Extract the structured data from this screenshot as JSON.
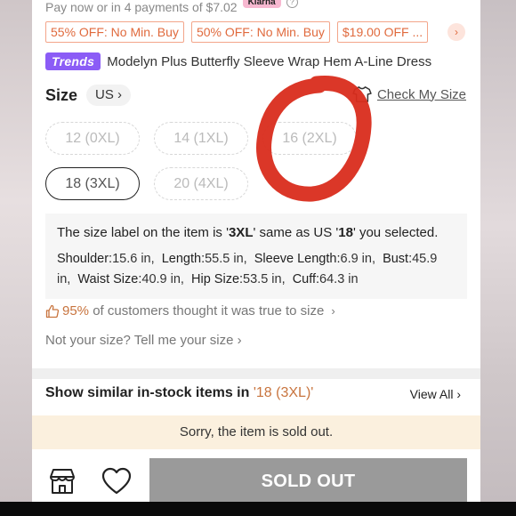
{
  "payment": {
    "text": "Pay now or in 4 payments of $7.02",
    "badge": "Klarna",
    "help": "?"
  },
  "coupons": [
    "55% OFF: No Min. Buy",
    "50% OFF: No Min. Buy",
    "$19.00 OFF ..."
  ],
  "coupons_more": "›",
  "product": {
    "badge": "Trends",
    "title": "Modelyn Plus Butterfly Sleeve Wrap Hem A-Line Dress"
  },
  "size_section": {
    "label": "Size",
    "region": "US ›",
    "check_my_size": "Check My Size"
  },
  "sizes": [
    {
      "label": "12 (0XL)",
      "selected": false
    },
    {
      "label": "14 (1XL)",
      "selected": false
    },
    {
      "label": "16 (2XL)",
      "selected": false
    },
    {
      "label": "18 (3XL)",
      "selected": true
    },
    {
      "label": "20 (4XL)",
      "selected": false
    }
  ],
  "size_info": {
    "pre": "The size label on the item is '",
    "item_label": "3XL",
    "mid": "' same as US '",
    "us_size": "18",
    "post": "' you selected.",
    "measurements": [
      {
        "k": "Shoulder:",
        "v": "15.6 in,"
      },
      {
        "k": "Length:",
        "v": "55.5 in,"
      },
      {
        "k": "Sleeve Length:",
        "v": "6.9 in,"
      },
      {
        "k": "Bust:",
        "v": "45.9 in,"
      },
      {
        "k": "Waist Size:",
        "v": "40.9 in,"
      },
      {
        "k": "Hip Size:",
        "v": "53.5 in,"
      },
      {
        "k": "Cuff:",
        "v": "64.3 in"
      }
    ]
  },
  "true_to_size": {
    "percent": "95%",
    "text": "of customers thought it was true to size",
    "chevron": "›"
  },
  "not_your_size": "Not your size? Tell me your size  ›",
  "similar": {
    "pre": "Show similar in-stock items in ",
    "size": "'18 (3XL)'",
    "view_all": "View All  ›"
  },
  "sold_out_notice": "Sorry, the item is sold out.",
  "buy_button": "SOLD OUT",
  "colors": {
    "accent": "#c8743e",
    "coupon": "#e06a3d",
    "trends": "#8b5cf6",
    "annotation": "#d92c1c"
  }
}
